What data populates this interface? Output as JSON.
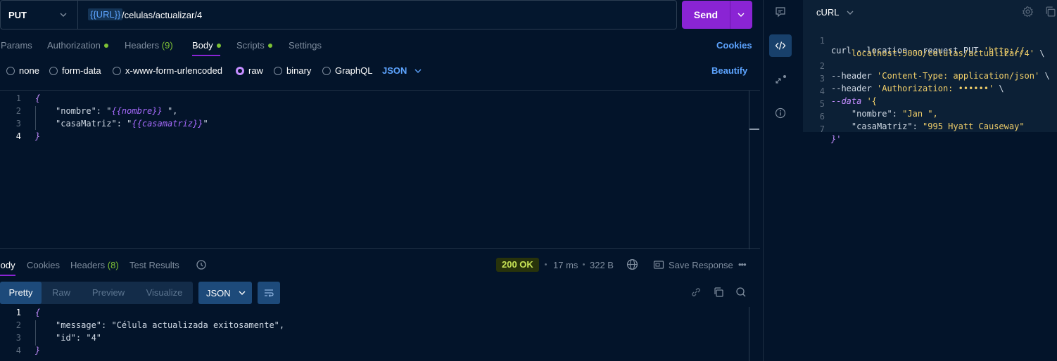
{
  "request": {
    "method": "PUT",
    "url_variable": "{{URL}}",
    "url_path": "/celulas/actualizar/4",
    "send_label": "Send"
  },
  "request_tabs": {
    "params": "Params",
    "authorization": "Authorization",
    "headers": "Headers",
    "headers_count": "(9)",
    "body": "Body",
    "scripts": "Scripts",
    "settings": "Settings",
    "cookies": "Cookies",
    "active": "Body"
  },
  "body_types": {
    "none": "none",
    "form_data": "form-data",
    "urlencoded": "x-www-form-urlencoded",
    "raw": "raw",
    "binary": "binary",
    "graphql": "GraphQL",
    "selected": "raw",
    "format": "JSON",
    "beautify": "Beautify"
  },
  "request_body": {
    "line_numbers": [
      "1",
      "2",
      "3",
      "4"
    ],
    "open_brace": "{",
    "close_brace": "}",
    "key1": "\"nombre\"",
    "val1": "{{nombre}}",
    "key2": "\"casaMatriz\"",
    "val2": "{{casamatriz}}"
  },
  "response_tabs": {
    "body": "Body",
    "cookies": "Cookies",
    "headers": "Headers",
    "headers_count": "(8)",
    "test_results": "Test Results"
  },
  "response_meta": {
    "status": "200 OK",
    "time": "17 ms",
    "size": "322 B",
    "save_response": "Save Response"
  },
  "response_view": {
    "pretty": "Pretty",
    "raw": "Raw",
    "preview": "Preview",
    "visualize": "Visualize",
    "format": "JSON"
  },
  "response_body": {
    "line_numbers": [
      "1",
      "2",
      "3",
      "4"
    ],
    "open_brace": "{",
    "close_brace": "}",
    "key1": "\"message\"",
    "val1": "\"Célula actualizada exitosamente\"",
    "key2": "\"id\"",
    "val2": "\"4\""
  },
  "curl": {
    "title": "cURL",
    "lines": [
      {
        "n": "1",
        "cmd": "curl --location --request PUT ",
        "str": "'http://"
      },
      {
        "n": "",
        "cmd": "",
        "str": "    localhost:5000/celulas/actualizar/4'",
        "tail": " \\"
      },
      {
        "n": "2",
        "cmd": "--header ",
        "str": "'Content-Type: application/json'",
        "tail": " \\"
      },
      {
        "n": "3",
        "cmd": "--header ",
        "str": "'Authorization: ••••••'",
        "tail": " \\"
      },
      {
        "n": "4",
        "flag": "--data ",
        "str": "'{"
      },
      {
        "n": "5",
        "cmd": "    \"nombre\": ",
        "str": "\"Jan \","
      },
      {
        "n": "6",
        "cmd": "    \"casaMatriz\": ",
        "str": "\"995 Hyatt Causeway\""
      },
      {
        "n": "7",
        "str": "}'"
      }
    ]
  },
  "icons": {
    "sidebar": [
      "comment-icon",
      "code-icon",
      "related-icon",
      "info-icon"
    ]
  }
}
